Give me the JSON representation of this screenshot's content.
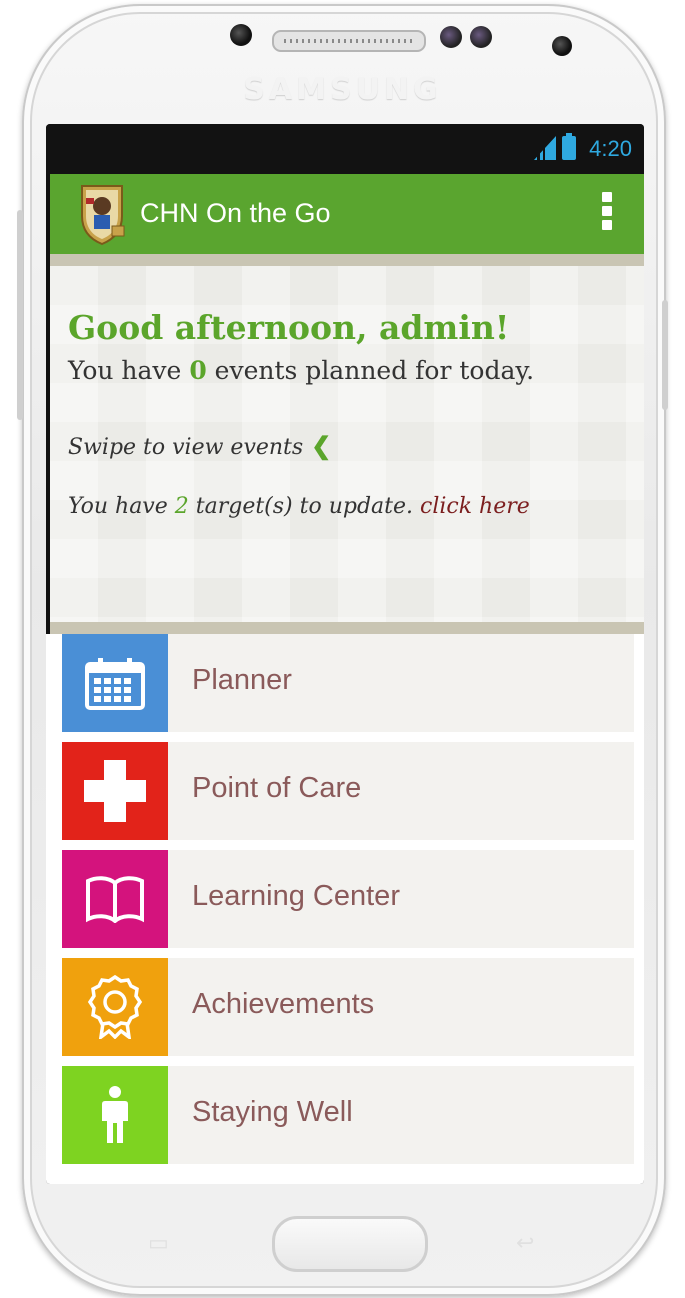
{
  "device": {
    "brand": "SAMSUNG"
  },
  "status_bar": {
    "time": "4:20"
  },
  "app_bar": {
    "title": "CHN On the Go"
  },
  "greeting": {
    "title": "Good afternoon, admin!",
    "events_prefix": "You have",
    "events_count": "0",
    "events_suffix": "events planned for today.",
    "swipe_text": "Swipe to view events",
    "swipe_chevron": "❮",
    "targets_prefix": "You have",
    "targets_count": "2",
    "targets_suffix": "target(s) to update.",
    "click_here": "click here"
  },
  "menu": {
    "items": [
      {
        "label": "Planner",
        "color": "#4a8fd6",
        "icon": "calendar-icon"
      },
      {
        "label": "Point of Care",
        "color": "#e2231a",
        "icon": "medical-cross-icon"
      },
      {
        "label": "Learning Center",
        "color": "#d4137d",
        "icon": "book-icon"
      },
      {
        "label": "Achievements",
        "color": "#f0a10d",
        "icon": "award-ribbon-icon"
      },
      {
        "label": "Staying Well",
        "color": "#7ed321",
        "icon": "person-icon"
      }
    ]
  },
  "colors": {
    "accent_green": "#5aa52f",
    "status_blue": "#2fa9e0",
    "link_maroon": "#7b1e1e"
  }
}
